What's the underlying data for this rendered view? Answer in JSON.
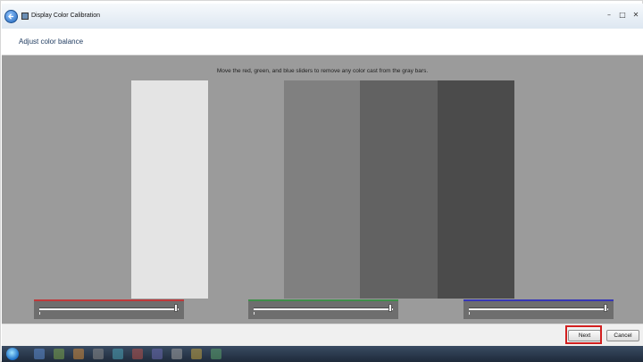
{
  "window": {
    "title": "Display Color Calibration",
    "controls": {
      "minimize": "–",
      "maximize": "□",
      "close": "✕"
    }
  },
  "header": {
    "title": "Adjust color balance"
  },
  "content": {
    "instruction": "Move the red, green, and blue sliders to remove any color cast from the gray bars.",
    "bars": [
      "#e4e4e4",
      "#9b9b9b",
      "#808080",
      "#626262",
      "#4b4b4b"
    ]
  },
  "sliders": [
    {
      "channel": "red",
      "accent": "#c0393b",
      "value_pct": 100
    },
    {
      "channel": "green",
      "accent": "#3f8f4a",
      "value_pct": 100
    },
    {
      "channel": "blue",
      "accent": "#3636b8",
      "value_pct": 100
    }
  ],
  "footer": {
    "next_label": "Next",
    "cancel_label": "Cancel",
    "highlight_color": "#d21f1f"
  },
  "taskbar": {
    "icons": [
      "start-orb",
      "app-icon-1",
      "app-icon-2",
      "app-icon-3",
      "app-icon-4",
      "app-icon-5",
      "app-icon-6",
      "app-icon-7",
      "app-icon-8",
      "app-icon-9",
      "app-icon-10"
    ]
  }
}
